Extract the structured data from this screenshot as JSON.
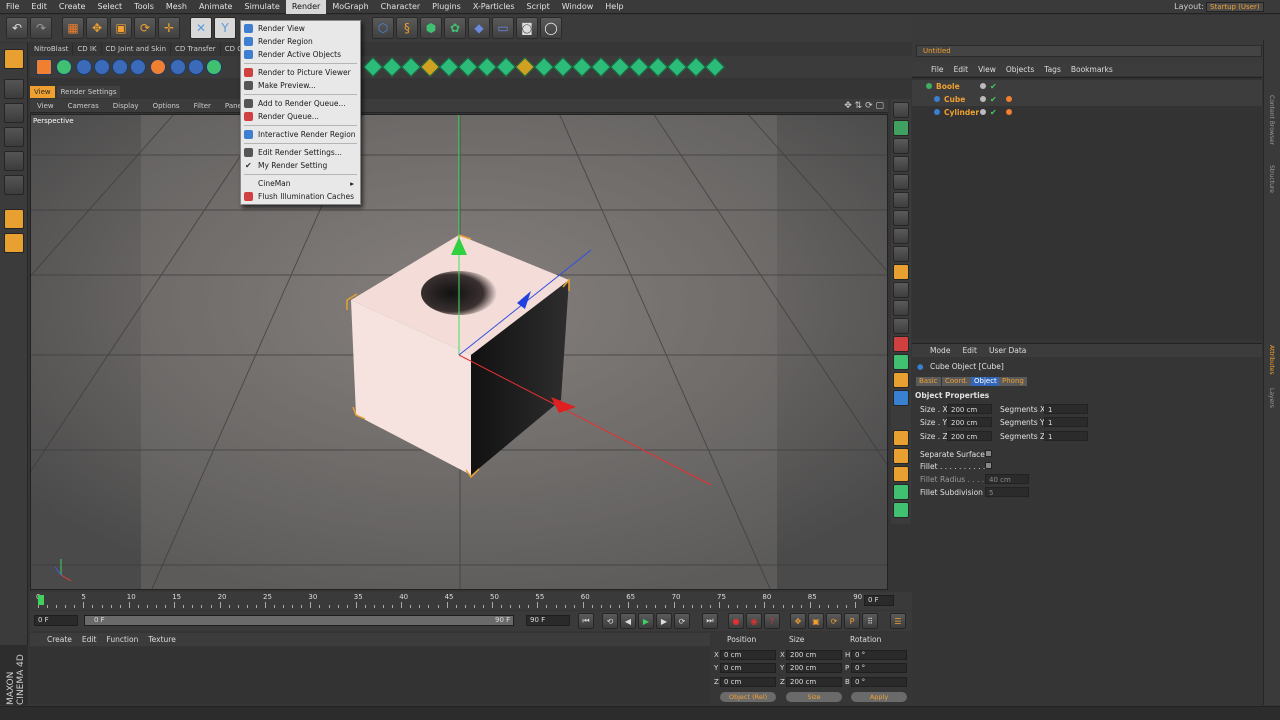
{
  "menubar": {
    "items": [
      "File",
      "Edit",
      "Create",
      "Select",
      "Tools",
      "Mesh",
      "Animate",
      "Simulate",
      "Render",
      "MoGraph",
      "Character",
      "Plugins",
      "X-Particles",
      "Script",
      "Window",
      "Help"
    ],
    "active": "Render",
    "layout_label": "Layout:",
    "layout_value": "Startup (User)"
  },
  "plugin_tabs": [
    "NitroBlast",
    "CD IK",
    "CD Joint and Skin",
    "CD Transfer",
    "CD Co"
  ],
  "render_menu": {
    "items": [
      {
        "label": "Render View",
        "icon": "render-view-icon",
        "color": "#3f7fd0"
      },
      {
        "label": "Render Region",
        "icon": "render-region-icon",
        "color": "#3f7fd0"
      },
      {
        "label": "Render Active Objects",
        "icon": "render-active-objects-icon",
        "color": "#3f7fd0"
      },
      {
        "label": "Render to Picture Viewer",
        "icon": "picture-viewer-icon",
        "color": "#d04040"
      },
      {
        "label": "Make Preview...",
        "icon": "make-preview-icon",
        "color": "#555555"
      },
      {
        "label": "Add to Render Queue...",
        "icon": "add-render-queue-icon",
        "color": "#555555"
      },
      {
        "label": "Render Queue...",
        "icon": "render-queue-icon",
        "color": "#d04040"
      },
      {
        "label": "Interactive Render Region",
        "icon": "interactive-render-region-icon",
        "color": "#3f7fd0"
      },
      {
        "label": "Edit Render Settings...",
        "icon": "edit-render-settings-icon",
        "color": "#555555"
      },
      {
        "label": "My Render Setting",
        "icon": "checkmark-icon",
        "color": "#333333"
      },
      {
        "label": "CineMan",
        "icon": "",
        "color": ""
      },
      {
        "label": "Flush Illumination Caches",
        "icon": "flush-caches-icon",
        "color": "#d04040"
      }
    ],
    "submenu_arrow": "▸"
  },
  "viewport": {
    "tabs": [
      "View",
      "Render Settings"
    ],
    "menu": [
      "View",
      "Cameras",
      "Display",
      "Options",
      "Filter",
      "Panel"
    ],
    "label": "Perspective"
  },
  "object_manager": {
    "title": "Untitled",
    "menu": [
      "File",
      "Edit",
      "View",
      "Objects",
      "Tags",
      "Bookmarks"
    ],
    "objects": [
      {
        "name": "Boole",
        "color": "#f0a030"
      },
      {
        "name": "Cube",
        "color": "#f0a030"
      },
      {
        "name": "Cylinder",
        "color": "#f0a030"
      }
    ]
  },
  "attribute_manager": {
    "menu": [
      "Mode",
      "Edit",
      "User Data"
    ],
    "object_title": "Cube Object [Cube]",
    "tabs": [
      "Basic",
      "Coord.",
      "Object",
      "Phong"
    ],
    "active_tab": "Object",
    "section": "Object Properties",
    "size_x_label": "Size . X",
    "size_x": "200 cm",
    "size_y_label": "Size . Y",
    "size_y": "200 cm",
    "size_z_label": "Size . Z",
    "size_z": "200 cm",
    "seg_x_label": "Segments X",
    "seg_x": "1",
    "seg_y_label": "Segments Y",
    "seg_y": "1",
    "seg_z_label": "Segments Z",
    "seg_z": "1",
    "separate_label": "Separate Surfaces",
    "fillet_label": "Fillet . . . . . . . . . . .",
    "fillet_radius_label": "Fillet Radius . . . .",
    "fillet_radius": "40 cm",
    "fillet_sub_label": "Fillet Subdivision",
    "fillet_sub": "5"
  },
  "timeline": {
    "ticks": [
      "0",
      "5",
      "10",
      "15",
      "20",
      "25",
      "30",
      "35",
      "40",
      "45",
      "50",
      "55",
      "60",
      "65",
      "70",
      "75",
      "80",
      "85",
      "90"
    ],
    "current_frame": "0 F"
  },
  "transport": {
    "start": "0 F",
    "range_start": "0 F",
    "range_end": "90 F",
    "end": "90 F"
  },
  "material_manager": {
    "menu": [
      "Create",
      "Edit",
      "Function",
      "Texture"
    ]
  },
  "coordinates": {
    "headers": [
      "Position",
      "Size",
      "Rotation"
    ],
    "rows": [
      {
        "axis": "X",
        "pos": "0 cm",
        "size_axis": "X",
        "size": "200 cm",
        "rot_axis": "H",
        "rot": "0 °"
      },
      {
        "axis": "Y",
        "pos": "0 cm",
        "size_axis": "Y",
        "size": "200 cm",
        "rot_axis": "P",
        "rot": "0 °"
      },
      {
        "axis": "Z",
        "pos": "0 cm",
        "size_axis": "Z",
        "size": "200 cm",
        "rot_axis": "B",
        "rot": "0 °"
      }
    ],
    "mode_select": "Object (Rel)",
    "size_select": "Size",
    "apply": "Apply"
  },
  "side_strip": [
    "Content Browser",
    "Structure",
    "Attributes",
    "Layers"
  ],
  "branding": "MAXON CINEMA 4D"
}
